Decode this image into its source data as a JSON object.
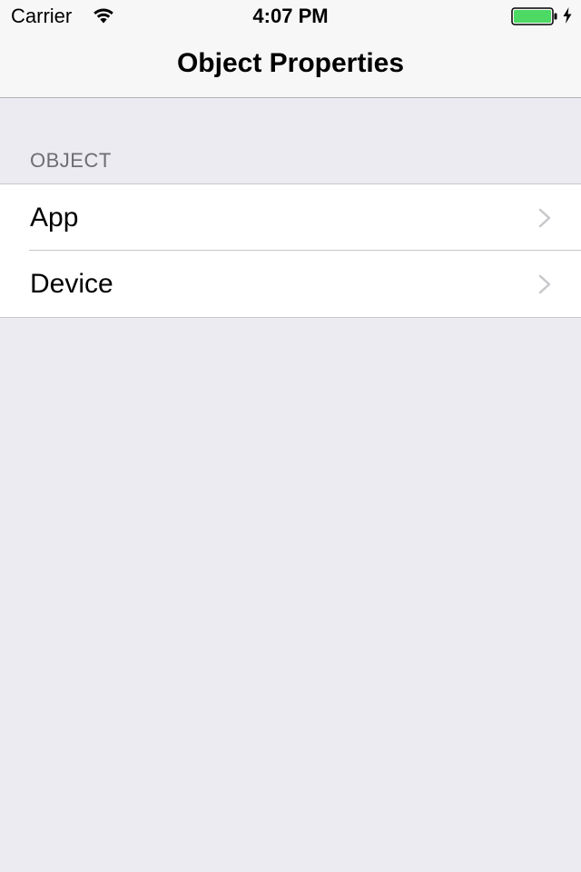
{
  "status_bar": {
    "carrier": "Carrier",
    "time": "4:07 PM",
    "icons": [
      "wifi-icon",
      "battery-icon",
      "charging-icon"
    ],
    "battery_color": "#4cd964"
  },
  "nav": {
    "title": "Object Properties"
  },
  "section": {
    "header": "OBJECT",
    "items": [
      {
        "label": "App",
        "icon": "chevron-right-icon"
      },
      {
        "label": "Device",
        "icon": "chevron-right-icon"
      }
    ]
  }
}
